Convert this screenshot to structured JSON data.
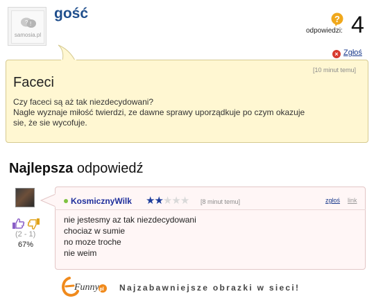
{
  "question": {
    "author": "gość",
    "avatar_logo_text": "samosia.pl",
    "answers_label": "odpowiedzi:",
    "answers_count": "4",
    "report_label": "Zgłoś",
    "time": "[10 minut temu]",
    "title": "Faceci",
    "body_lines": [
      "Czy faceci są aż tak niezdecydowani?",
      "Nagle wyznaje miłość twierdzi, ze dawne sprawy uporządkuje po czym okazuje",
      "sie, że sie wycofuje."
    ]
  },
  "best_answer": {
    "heading_bold": "Najlepsza",
    "heading_rest": "odpowiedź",
    "votes": "(2 - 1)",
    "percent": "67%",
    "author": "KosmicznyWilk",
    "rating": {
      "filled": 2,
      "total": 5
    },
    "time": "[8 minut temu]",
    "report_label": "zgłoś",
    "link_label": "link",
    "body_lines": [
      "nie jestesmy az tak niezdecydowani",
      "chociaz w sumie",
      "no moze troche",
      "nie weim"
    ]
  },
  "footer": {
    "logo_text": "Funny",
    "logo_suffix": "pl",
    "tagline": "Najzabawniejsze obrazki w sieci!"
  },
  "colors": {
    "username": "#1f4e8c",
    "question_bg": "#fff7d2",
    "answer_bg": "#fff6f6",
    "answer_author": "#1f2f9c",
    "star_on": "#1d3d9c",
    "report_icon": "#d83a2e",
    "thumb_up": "#8a5fc7",
    "thumb_down": "#e0a31a",
    "logo_orange": "#f08a1c"
  }
}
